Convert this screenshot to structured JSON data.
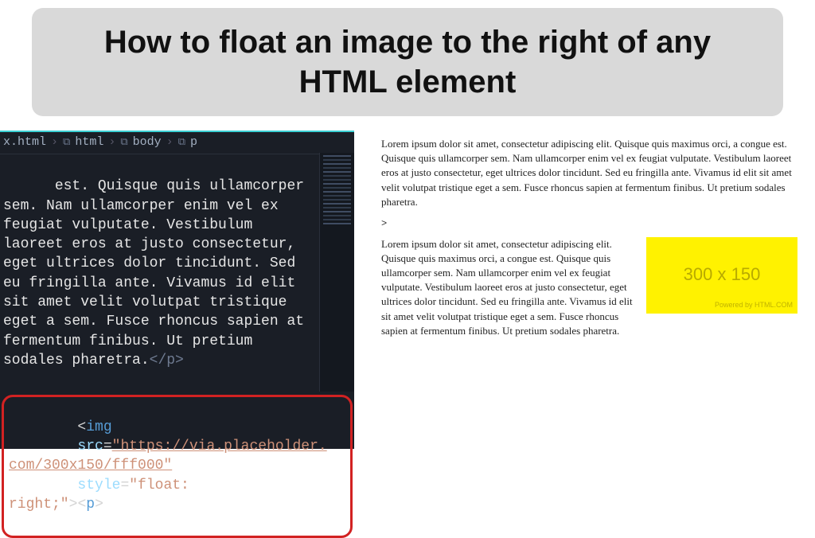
{
  "title": "How to float an image to the right of any HTML element",
  "breadcrumb": {
    "file": "x.html",
    "segments": [
      "html",
      "body",
      "p"
    ]
  },
  "code": {
    "body_text": "est. Quisque quis ullamcorper sem. Nam ullamcorper enim vel ex feugiat vulputate. Vestibulum laoreet eros at justo consectetur, eget ultrices dolor tincidunt. Sed eu fringilla ante. Vivamus id elit sit amet velit volutpat tristique eget a sem. Fusce rhoncus sapien at fermentum finibus. Ut pretium sodales pharetra.",
    "close_p": "</p>",
    "img_tag_open": "<img",
    "img_src_attr": "src",
    "img_src_val": "https://via.placeholder.com/300x150/fff000",
    "img_style_attr": "style",
    "img_style_val": "float:right;",
    "img_close": ">",
    "p_open": "<p>"
  },
  "preview": {
    "para1": "Lorem ipsum dolor sit amet, consectetur adipiscing elit. Quisque quis maximus orci, a congue est. Quisque quis ullamcorper sem. Nam ullamcorper enim vel ex feugiat vulputate. Vestibulum laoreet eros at justo consectetur, eget ultrices dolor tincidunt. Sed eu fringilla ante. Vivamus id elit sit amet velit volutpat tristique eget a sem. Fusce rhoncus sapien at fermentum finibus. Ut pretium sodales pharetra.",
    "gt": ">",
    "para2": "Lorem ipsum dolor sit amet, consectetur adipiscing elit. Quisque quis maximus orci, a congue est. Quisque quis ullamcorper sem. Nam ullamcorper enim vel ex feugiat vulputate. Vestibulum laoreet eros at justo consectetur, eget ultrices dolor tincidunt. Sed eu fringilla ante. Vivamus id elit sit amet velit volutpat tristique eget a sem. Fusce rhoncus sapien at fermentum finibus. Ut pretium sodales pharetra.",
    "placeholder": {
      "dims": "300 x 150",
      "powered": "Powered by HTML.COM"
    }
  }
}
